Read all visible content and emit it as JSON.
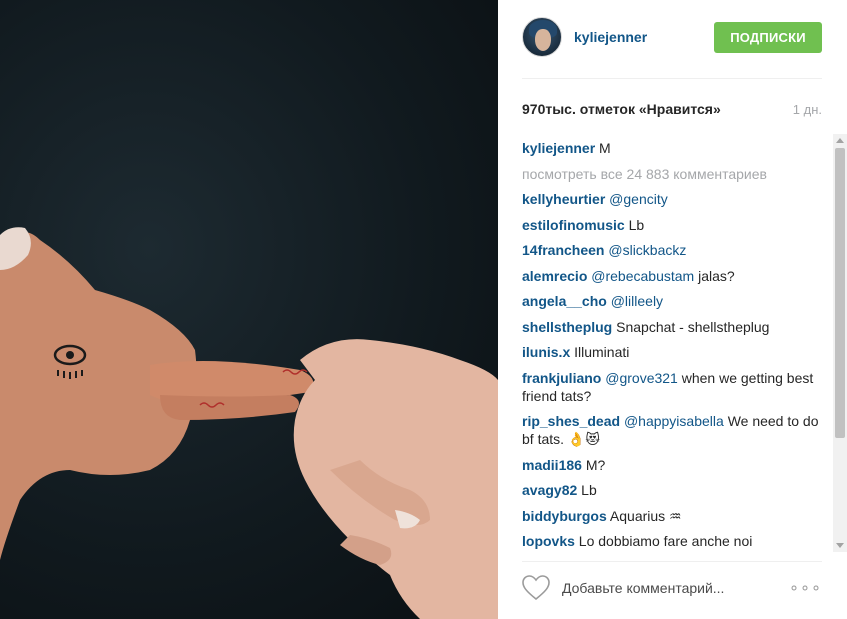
{
  "post": {
    "username": "kyliejenner",
    "follow_label": "ПОДПИСКИ",
    "likes": "970тыс. отметок «Нравится»",
    "time": "1 дн."
  },
  "caption": {
    "user": "kyliejenner",
    "text": "M"
  },
  "view_all": "посмотреть все 24 883 комментариев",
  "comments": [
    {
      "user": "kellyheurtier",
      "mention": "@gencity",
      "text": ""
    },
    {
      "user": "estilofinomusic",
      "mention": "",
      "text": "Lb"
    },
    {
      "user": "14francheen",
      "mention": "@slickbackz",
      "text": ""
    },
    {
      "user": "alemrecio",
      "mention": "@rebecabustam",
      "text": "jalas?"
    },
    {
      "user": "angela__cho",
      "mention": "@lilleely",
      "text": ""
    },
    {
      "user": "shellstheplug",
      "mention": "",
      "text": "Snapchat - shellstheplug"
    },
    {
      "user": "ilunis.x",
      "mention": "",
      "text": "Illuminati"
    },
    {
      "user": "frankjuliano",
      "mention": "@grove321",
      "text": "when we getting best friend tats?"
    },
    {
      "user": "rip_shes_dead",
      "mention": "@happyisabella",
      "text": "We need to do bf tats. 👌😻"
    },
    {
      "user": "madii186",
      "mention": "",
      "text": "M?"
    },
    {
      "user": "avagy82",
      "mention": "",
      "text": "Lb"
    },
    {
      "user": "biddyburgos",
      "mention": "",
      "text": "Aquarius ♒"
    },
    {
      "user": "lopovks",
      "mention": "",
      "text": "Lo dobbiamo fare anche noi"
    }
  ],
  "footer": {
    "placeholder": "Добавьте комментарий...",
    "more": "∘∘∘"
  },
  "icons": {
    "like": "heart-icon",
    "more": "more-options-icon"
  },
  "colors": {
    "follow": "#70c050",
    "username": "#125688",
    "muted": "#a5a7aa"
  }
}
